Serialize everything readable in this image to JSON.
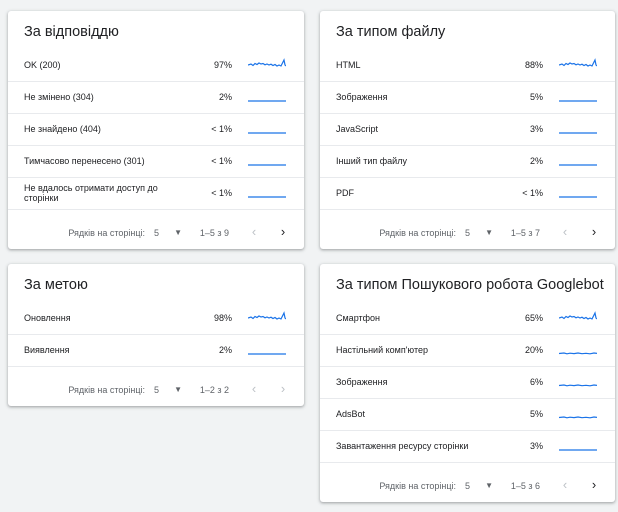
{
  "colors": {
    "accent": "#1a73e8",
    "background": "#f1f3f4",
    "card": "#ffffff"
  },
  "cards": [
    {
      "title": "За відповіддю",
      "rows": [
        {
          "label": "OK (200)",
          "pct": "97%",
          "spark": "wavy"
        },
        {
          "label": "Не змінено (304)",
          "pct": "2%",
          "spark": "flat"
        },
        {
          "label": "Не знайдено (404)",
          "pct": "< 1%",
          "spark": "flat"
        },
        {
          "label": "Тимчасово перенесено (301)",
          "pct": "< 1%",
          "spark": "flat"
        },
        {
          "label": "Не вдалось отримати доступ до сторінки",
          "pct": "< 1%",
          "spark": "flat"
        }
      ],
      "footer": {
        "rows_per_page_label": "Рядків на сторінці:",
        "rows_per_page": "5",
        "range": "1–5 з 9",
        "next_enabled": true
      }
    },
    {
      "title": "За типом файлу",
      "rows": [
        {
          "label": "HTML",
          "pct": "88%",
          "spark": "wavy"
        },
        {
          "label": "Зображення",
          "pct": "5%",
          "spark": "flat"
        },
        {
          "label": "JavaScript",
          "pct": "3%",
          "spark": "flat"
        },
        {
          "label": "Інший тип файлу",
          "pct": "2%",
          "spark": "flat"
        },
        {
          "label": "PDF",
          "pct": "< 1%",
          "spark": "flat"
        }
      ],
      "footer": {
        "rows_per_page_label": "Рядків на сторінці:",
        "rows_per_page": "5",
        "range": "1–5 з 7",
        "next_enabled": true
      }
    },
    {
      "title": "За метою",
      "rows": [
        {
          "label": "Оновлення",
          "pct": "98%",
          "spark": "wavy"
        },
        {
          "label": "Виявлення",
          "pct": "2%",
          "spark": "flat"
        }
      ],
      "footer": {
        "rows_per_page_label": "Рядків на сторінці:",
        "rows_per_page": "5",
        "range": "1–2 з 2",
        "next_enabled": false
      }
    },
    {
      "title": "За типом Пошукового робота Googlebot",
      "rows": [
        {
          "label": "Смартфон",
          "pct": "65%",
          "spark": "wavy"
        },
        {
          "label": "Настільний комп'ютер",
          "pct": "20%",
          "spark": "small"
        },
        {
          "label": "Зображення",
          "pct": "6%",
          "spark": "small"
        },
        {
          "label": "AdsBot",
          "pct": "5%",
          "spark": "small"
        },
        {
          "label": "Завантаження ресурсу сторінки",
          "pct": "3%",
          "spark": "flat"
        }
      ],
      "footer": {
        "rows_per_page_label": "Рядків на сторінці:",
        "rows_per_page": "5",
        "range": "1–5 з 6",
        "next_enabled": true
      }
    }
  ]
}
